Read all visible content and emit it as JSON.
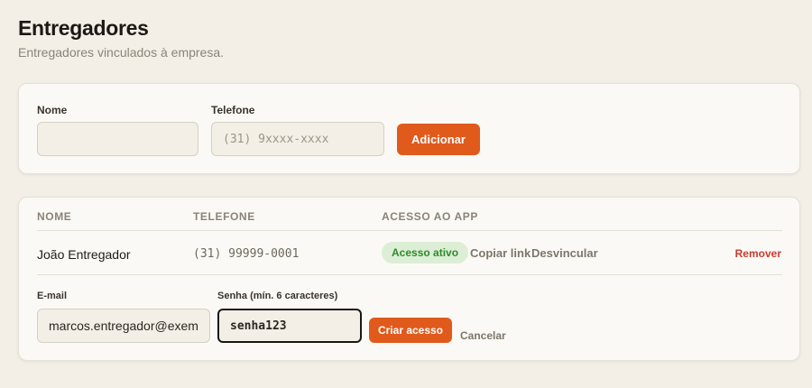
{
  "header": {
    "title": "Entregadores",
    "subtitle": "Entregadores vinculados à empresa."
  },
  "add_form": {
    "name_label": "Nome",
    "name_value": "",
    "name_placeholder": "",
    "phone_label": "Telefone",
    "phone_value": "",
    "phone_placeholder": "(31) 9xxxx-xxxx",
    "submit_label": "Adicionar"
  },
  "table": {
    "columns": [
      "NOME",
      "TELEFONE",
      "ACESSO AO APP"
    ],
    "rows": [
      {
        "name": "João Entregador",
        "phone": "(31) 99999-0001",
        "access_badge": "Acesso ativo",
        "copy_link_label": "Copiar link",
        "unlink_label": "Desvincular",
        "remove_label": "Remover"
      }
    ]
  },
  "access_form": {
    "email_label": "E-mail",
    "email_value": "marcos.entregador@exemp",
    "password_label": "Senha (mín. 6 caracteres)",
    "password_value": "senha123",
    "create_label": "Criar acesso",
    "cancel_label": "Cancelar"
  },
  "colors": {
    "accent": "#e05a1c",
    "background": "#f3efe7",
    "card": "#fbf9f5",
    "success_bg": "#dcefd6",
    "success_text": "#2f8a2b",
    "danger": "#c93a2f"
  }
}
